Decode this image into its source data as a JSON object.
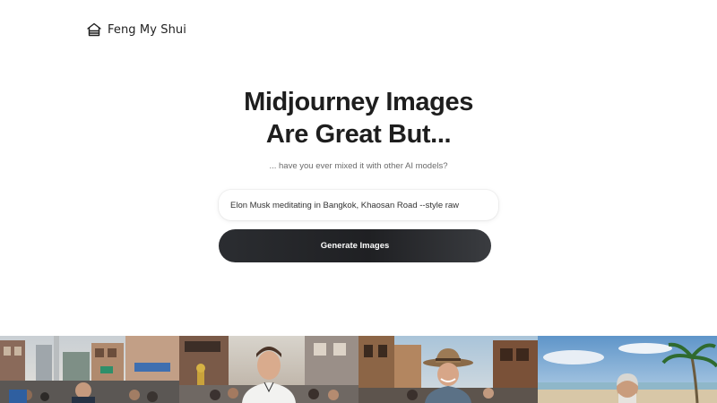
{
  "brand": {
    "name": "Feng My Shui",
    "icon": "house-icon"
  },
  "hero": {
    "title_line1": "Midjourney Images",
    "title_line2": "Are Great But...",
    "subtitle": "... have you ever mixed it with other AI models?"
  },
  "prompt": {
    "value": "Elon Musk meditating in Bangkok, Khaosan Road --style raw"
  },
  "generate_button": {
    "label": "Generate Images"
  },
  "gallery": {
    "images": [
      "street-scene-image",
      "man-in-crowd-image",
      "man-in-hat-image",
      "beach-palm-image"
    ]
  },
  "colors": {
    "button_bg": "#25272b",
    "title": "#1e1e1e",
    "subtitle": "#6b6b6b"
  }
}
